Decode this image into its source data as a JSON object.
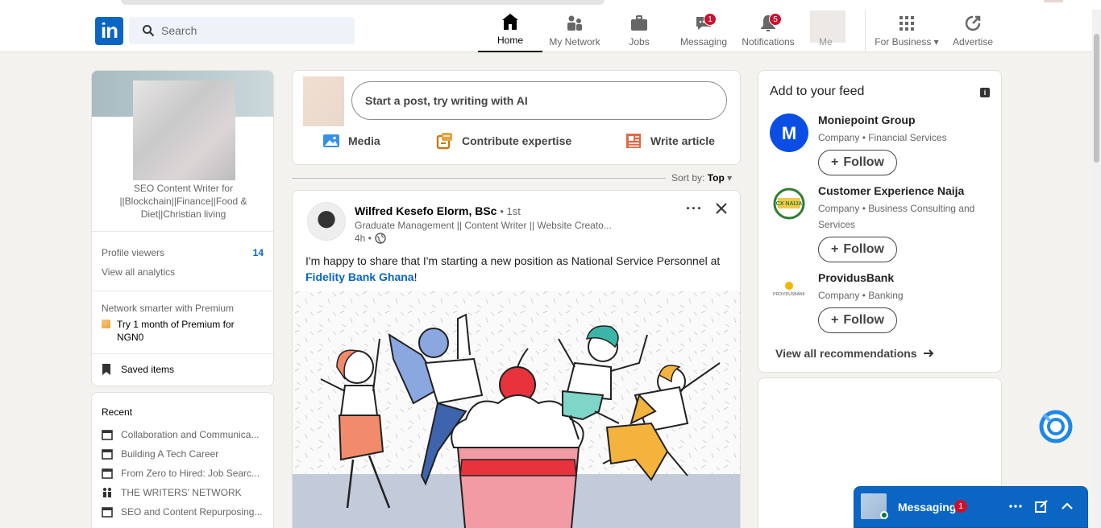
{
  "header": {
    "logo_text": "in",
    "search_placeholder": "Search",
    "nav": [
      {
        "label": "Home"
      },
      {
        "label": "My Network"
      },
      {
        "label": "Jobs"
      },
      {
        "label": "Messaging",
        "badge": "1"
      },
      {
        "label": "Notifications",
        "badge": "5"
      },
      {
        "label": "Me"
      },
      {
        "label": "For Business"
      },
      {
        "label": "Advertise"
      }
    ]
  },
  "profile": {
    "headline": "SEO Content Writer for ||Blockchain||Finance||Food & Diet||Christian living",
    "profile_viewers_label": "Profile viewers",
    "profile_viewers_count": "14",
    "view_analytics": "View all analytics",
    "premium_prompt": "Network smarter with Premium",
    "premium_offer": "Try 1 month of Premium for NGN0",
    "saved_items": "Saved items"
  },
  "recent": {
    "title": "Recent",
    "items": [
      "Collaboration and Communica...",
      "Building A Tech Career",
      "From Zero to Hired: Job Searc...",
      "THE WRITERS' NETWORK",
      "SEO and Content Repurposing..."
    ]
  },
  "share": {
    "placeholder": "Start a post, try writing with AI",
    "media": "Media",
    "contribute": "Contribute expertise",
    "write_article": "Write article"
  },
  "sort": {
    "label": "Sort by:",
    "value": "Top"
  },
  "post": {
    "author": "Wilfred Kesefo Elorm, BSc",
    "degree": "• 1st",
    "subtitle": "Graduate Management || Content Writer || Website Creato...",
    "time": "4h •",
    "text_before": "I'm happy to share that I'm starting a new position as National Service Personnel at ",
    "link": "Fidelity Bank Ghana",
    "text_after": "!"
  },
  "feed": {
    "title": "Add to your feed",
    "companies": [
      {
        "name": "Moniepoint Group",
        "subtitle": "Company • Financial Services",
        "follow": "Follow",
        "color": "#0a4ee4"
      },
      {
        "name": "Customer Experience Naija",
        "subtitle": "Company • Business Consulting and Services",
        "follow": "Follow",
        "color": "#2e7d32",
        "logo_text": "CX NAIJA"
      },
      {
        "name": "ProvidusBank",
        "subtitle": "Company • Banking",
        "follow": "Follow",
        "color": "#f2b600",
        "logo_text": "PROVIDUSBANK"
      }
    ],
    "view_all": "View all recommendations"
  },
  "messaging": {
    "title": "Messaging",
    "badge": "1"
  }
}
